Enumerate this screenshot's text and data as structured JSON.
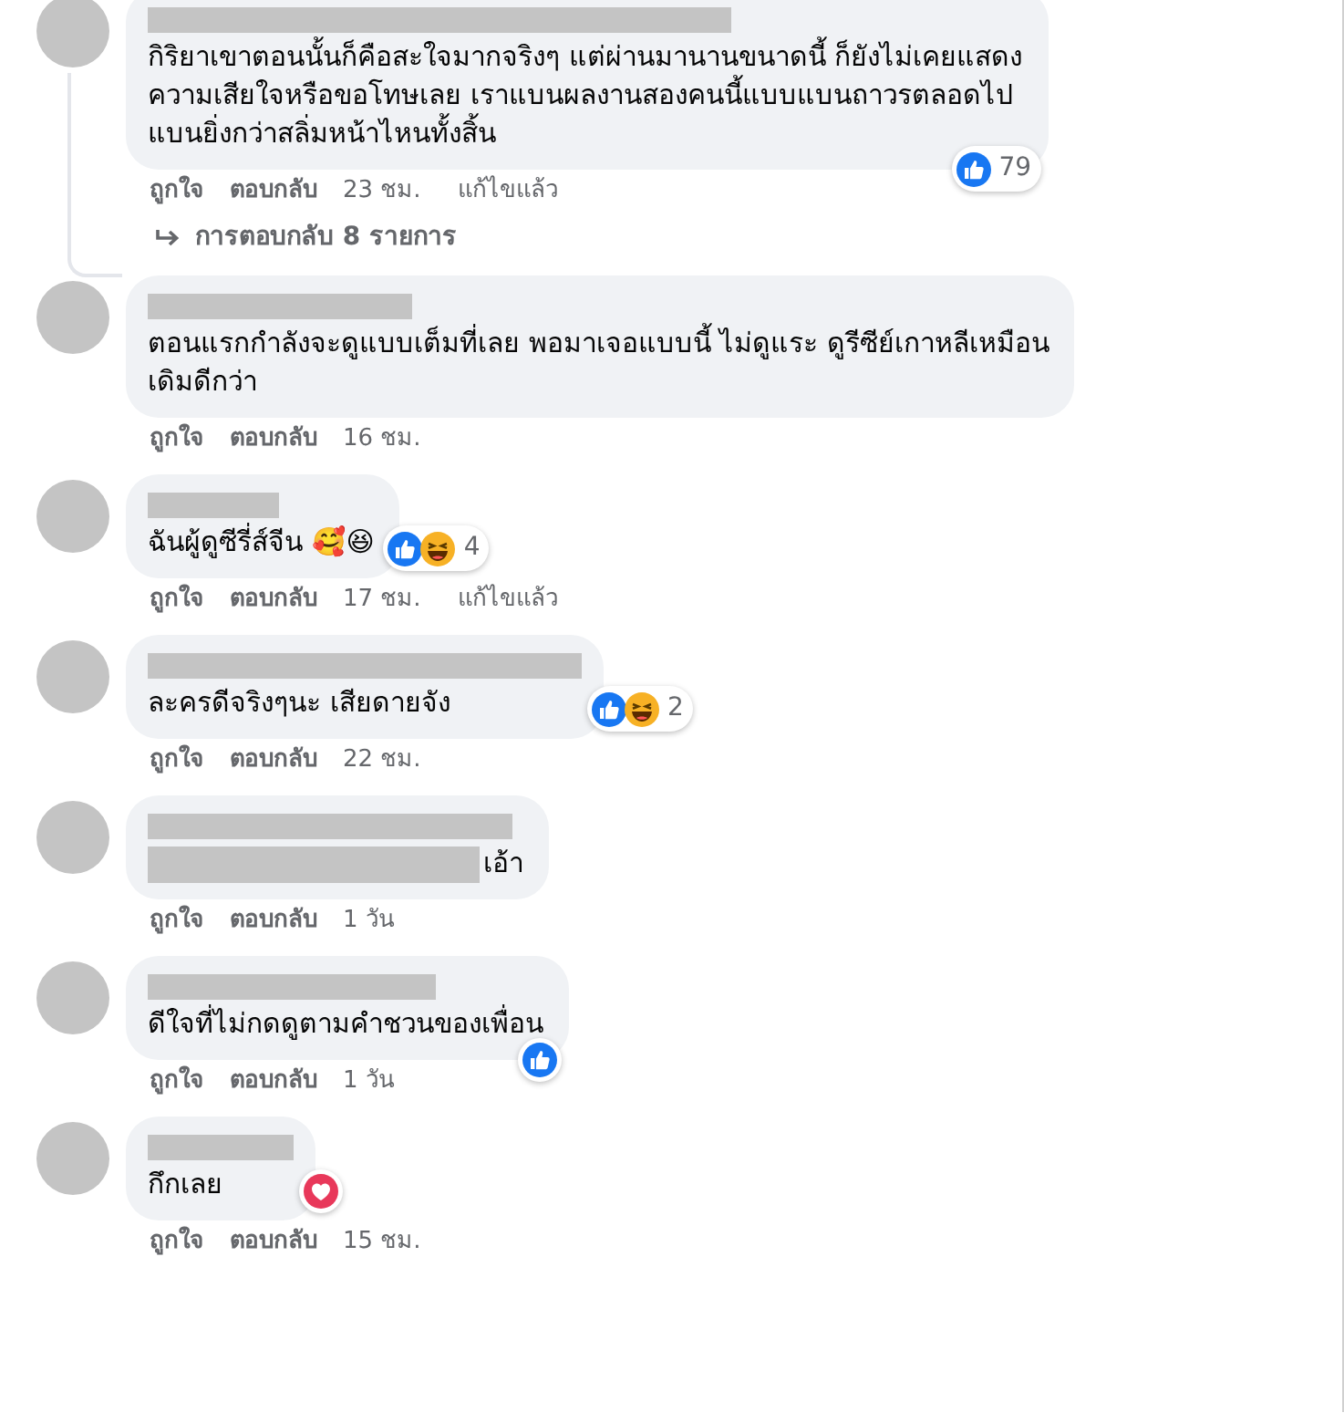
{
  "comments": [
    {
      "name_redacted": true,
      "lines": [
        "กิริยาเขาตอนนั้นก็คือสะใจมากจริงๆ แต่ผ่านมานานขนาดนี้ ก็ยังไม่เคยแสดง",
        "ความเสียใจหรือขอโทษเลย เราแบนผลงานสองคนนี้แบบแบนถาวรตลอดไป",
        "แบนยิ่งกว่าสลิ่มหน้าไหนทั้งสิ้น"
      ],
      "reactions": [
        {
          "kind": "like"
        }
      ],
      "reaction_count": "79",
      "actions": {
        "like": "ถูกใจ",
        "reply": "ตอบกลับ",
        "time": "23 ชม.",
        "edited": "แก้ไขแล้ว"
      },
      "replies_link": "การตอบกลับ 8 รายการ"
    },
    {
      "name_redacted": true,
      "lines": [
        "ตอนแรกกำลังจะดูแบบเต็มที่เลย พอมาเจอแบบนี้ ไม่ดูแระ ดูรีซีย์เกาหลีเหมือน",
        "เดิมดีกว่า"
      ],
      "actions": {
        "like": "ถูกใจ",
        "reply": "ตอบกลับ",
        "time": "16 ชม."
      }
    },
    {
      "name_redacted": true,
      "lines": [
        "ฉันผู้ดูซีรี่ส์จีน 🥰😆"
      ],
      "reactions": [
        {
          "kind": "like"
        },
        {
          "kind": "haha"
        }
      ],
      "reaction_count": "4",
      "actions": {
        "like": "ถูกใจ",
        "reply": "ตอบกลับ",
        "time": "17 ชม.",
        "edited": "แก้ไขแล้ว"
      }
    },
    {
      "name_redacted": true,
      "lines": [
        "ละครดีจริงๆนะ เสียดายจัง"
      ],
      "reactions": [
        {
          "kind": "like"
        },
        {
          "kind": "haha"
        }
      ],
      "reaction_count": "2",
      "actions": {
        "like": "ถูกใจ",
        "reply": "ตอบกลับ",
        "time": "22 ชม."
      }
    },
    {
      "name_redacted": true,
      "text_redacted_prefix": true,
      "lines": [
        "เอ้า"
      ],
      "actions": {
        "like": "ถูกใจ",
        "reply": "ตอบกลับ",
        "time": "1 วัน"
      }
    },
    {
      "name_redacted": true,
      "lines": [
        "ดีใจที่ไม่กดดูตามคำชวนของเพื่อน"
      ],
      "reactions": [
        {
          "kind": "like"
        }
      ],
      "actions": {
        "like": "ถูกใจ",
        "reply": "ตอบกลับ",
        "time": "1 วัน"
      }
    },
    {
      "name_redacted": true,
      "lines": [
        "กึกเลย"
      ],
      "reactions": [
        {
          "kind": "love"
        }
      ],
      "actions": {
        "like": "ถูกใจ",
        "reply": "ตอบกลับ",
        "time": "15 ชม."
      }
    }
  ]
}
